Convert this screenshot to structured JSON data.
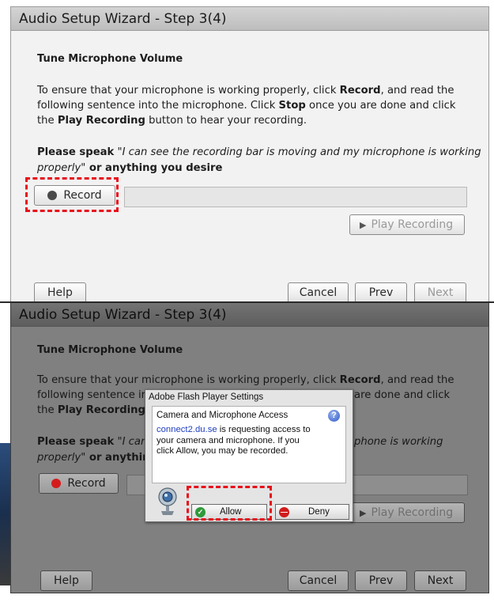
{
  "top_panel": {
    "title": "Audio Setup Wizard - Step 3(4)",
    "heading": "Tune Microphone Volume",
    "instr_line1_pre": "To ensure that your microphone is working properly, click ",
    "instr_line1_bold": "Record",
    "instr_line1_post": ", and read the",
    "instr_line2_pre": "following sentence into the microphone. Click ",
    "instr_line2_bold": "Stop",
    "instr_line2_post": " once you are done and click",
    "instr_line3_pre": "the ",
    "instr_line3_bold": "Play Recording",
    "instr_line3_post": " button to hear your recording.",
    "speak_label": "Please speak",
    "speak_quote_1": "\"I can see the recording bar is moving and my microphone is working",
    "speak_quote_2": "properly\"",
    "speak_suffix": " or anything you desire",
    "record_label": "Record",
    "play_label": "Play Recording",
    "help_label": "Help",
    "cancel_label": "Cancel",
    "prev_label": "Prev",
    "next_label": "Next"
  },
  "bottom_panel": {
    "title": "Audio Setup Wizard - Step 3(4)",
    "heading": "Tune Microphone Volume",
    "instr_line1_pre": "To ensure that your microphone is working properly, click ",
    "instr_line1_bold": "Record",
    "instr_line1_post": ", and read the",
    "instr_line2_left": "following sentence ir",
    "instr_line2_right": "are done and click",
    "instr_line3_pre": "the ",
    "instr_line3_bold": "Play Recording",
    "instr_line3_cut": " I",
    "speak_label": "Please speak",
    "speak_quote_left": "\"I can :",
    "speak_quote_right": "phone is working",
    "speak_line2_italic": "properly\"",
    "speak_line2_suffix": " or anything",
    "record_label": "Record",
    "play_label": "Play Recording",
    "help_label": "Help",
    "cancel_label": "Cancel",
    "prev_label": "Prev",
    "next_label": "Next"
  },
  "flash_dialog": {
    "title": "Adobe Flash Player Settings",
    "heading": "Camera and Microphone Access",
    "domain": "connect2.du.se",
    "message_1": " is requesting access to",
    "message_2": "your camera and microphone. If you",
    "message_3": "click Allow, you may be recorded.",
    "help_glyph": "?",
    "allow_label": "Allow",
    "deny_label": "Deny"
  },
  "icons": {
    "record_dot_top": "record-dot-icon",
    "record_dot_bottom": "record-dot-icon",
    "play": "play-triangle-icon",
    "help": "question-mark-icon",
    "camera": "webcam-icon",
    "allow": "check-icon",
    "deny": "no-entry-icon"
  },
  "colors": {
    "highlight": "#e8101a",
    "record_dot_idle": "#4a4a4a",
    "record_dot_active": "#d41b1b",
    "link": "#1f3fbf"
  }
}
